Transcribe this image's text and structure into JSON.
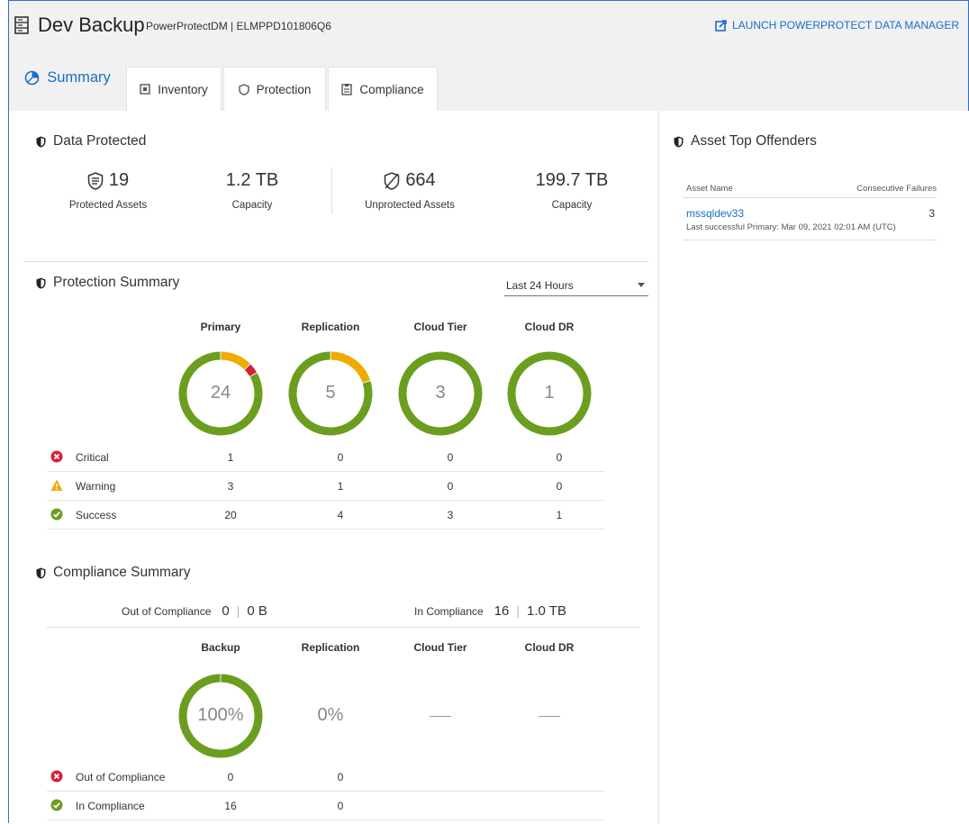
{
  "header": {
    "title": "Dev Backup",
    "subtitle": "PowerProtectDM | ELMPPD101806Q6",
    "launch_label": "LAUNCH POWERPROTECT DATA MANAGER"
  },
  "tabs": [
    {
      "label": "Summary",
      "icon": "pie-chart-icon",
      "active": true
    },
    {
      "label": "Inventory",
      "icon": "inventory-icon"
    },
    {
      "label": "Protection",
      "icon": "shield-icon"
    },
    {
      "label": "Compliance",
      "icon": "clipboard-icon"
    }
  ],
  "data_protected": {
    "title": "Data Protected",
    "protected_count": "19",
    "protected_label": "Protected Assets",
    "protected_capacity": "1.2 TB",
    "capacity_label": "Capacity",
    "unprotected_count": "664",
    "unprotected_label": "Unprotected Assets",
    "unprotected_capacity": "199.7 TB",
    "capacity_label_2": "Capacity"
  },
  "protection_summary": {
    "title": "Protection Summary",
    "range": "Last 24 Hours",
    "columns": [
      "Primary",
      "Replication",
      "Cloud Tier",
      "Cloud DR"
    ],
    "totals": [
      "24",
      "5",
      "3",
      "1"
    ],
    "rows": [
      {
        "label": "Critical",
        "status": "critical",
        "values": [
          "1",
          "0",
          "0",
          "0"
        ]
      },
      {
        "label": "Warning",
        "status": "warning",
        "values": [
          "3",
          "1",
          "0",
          "0"
        ]
      },
      {
        "label": "Success",
        "status": "success",
        "values": [
          "20",
          "4",
          "3",
          "1"
        ]
      }
    ],
    "breakdown": [
      {
        "critical": 1,
        "warning": 3,
        "success": 20
      },
      {
        "critical": 0,
        "warning": 1,
        "success": 4
      },
      {
        "critical": 0,
        "warning": 0,
        "success": 3
      },
      {
        "critical": 0,
        "warning": 0,
        "success": 1
      }
    ]
  },
  "compliance_summary": {
    "title": "Compliance Summary",
    "out_label": "Out of Compliance",
    "out_count": "0",
    "out_size": "0 B",
    "in_label": "In Compliance",
    "in_count": "16",
    "in_size": "1.0 TB",
    "columns": [
      "Backup",
      "Replication",
      "Cloud Tier",
      "Cloud DR"
    ],
    "percent_backup": "100%",
    "percent_replication": "0%",
    "backup_fraction": 1.0,
    "rows": [
      {
        "label": "Out of Compliance",
        "status": "critical",
        "values": [
          "0",
          "0"
        ]
      },
      {
        "label": "In Compliance",
        "status": "success",
        "values": [
          "16",
          "0"
        ]
      }
    ]
  },
  "top_offenders": {
    "title": "Asset Top Offenders",
    "col_name": "Asset Name",
    "col_failures": "Consecutive Failures",
    "items": [
      {
        "name": "mssqldev33",
        "failures": "3",
        "detail": "Last successful Primary: Mar 09, 2021 02:01 AM (UTC)"
      }
    ]
  },
  "colors": {
    "accent": "#1a6ec8",
    "success": "#6b9e1f",
    "warning": "#f0ab00",
    "critical": "#d0233a"
  }
}
